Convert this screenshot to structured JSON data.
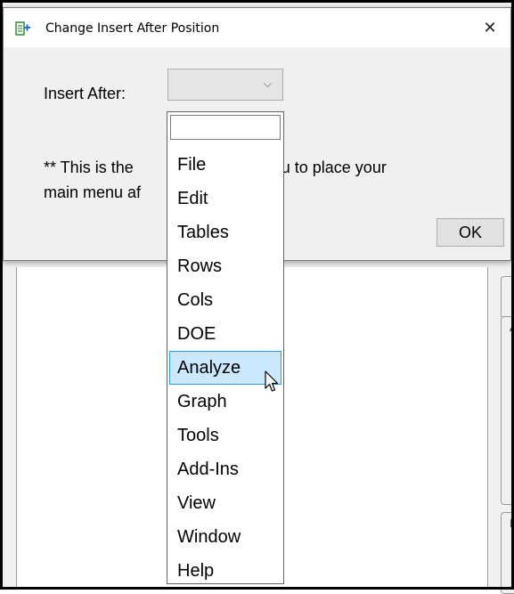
{
  "dialog": {
    "title": "Change Insert After Position",
    "close_glyph": "✕",
    "insert_label": "Insert After:",
    "selected_value": "",
    "note_line1": "** This is the",
    "note_line1_tail": "n menu to place your",
    "note_line2": "main menu af",
    "ok_label": "OK"
  },
  "dropdown": {
    "search_value": "",
    "items": [
      "File",
      "Edit",
      "Tables",
      "Rows",
      "Cols",
      "DOE",
      "Analyze",
      "Graph",
      "Tools",
      "Add-Ins",
      "View",
      "Window",
      "Help"
    ],
    "highlighted": "Analyze"
  },
  "background": {
    "right_letter_a": "A",
    "right_letter_b": "I"
  },
  "colors": {
    "highlight_bg": "#cce8ff",
    "highlight_border": "#26a0da",
    "title_icon": "#2e8b3d"
  },
  "icons": {
    "title": "jmp-addin-icon",
    "close": "close-icon",
    "combo": "chevron-down-icon",
    "cursor": "mouse-pointer-icon"
  }
}
